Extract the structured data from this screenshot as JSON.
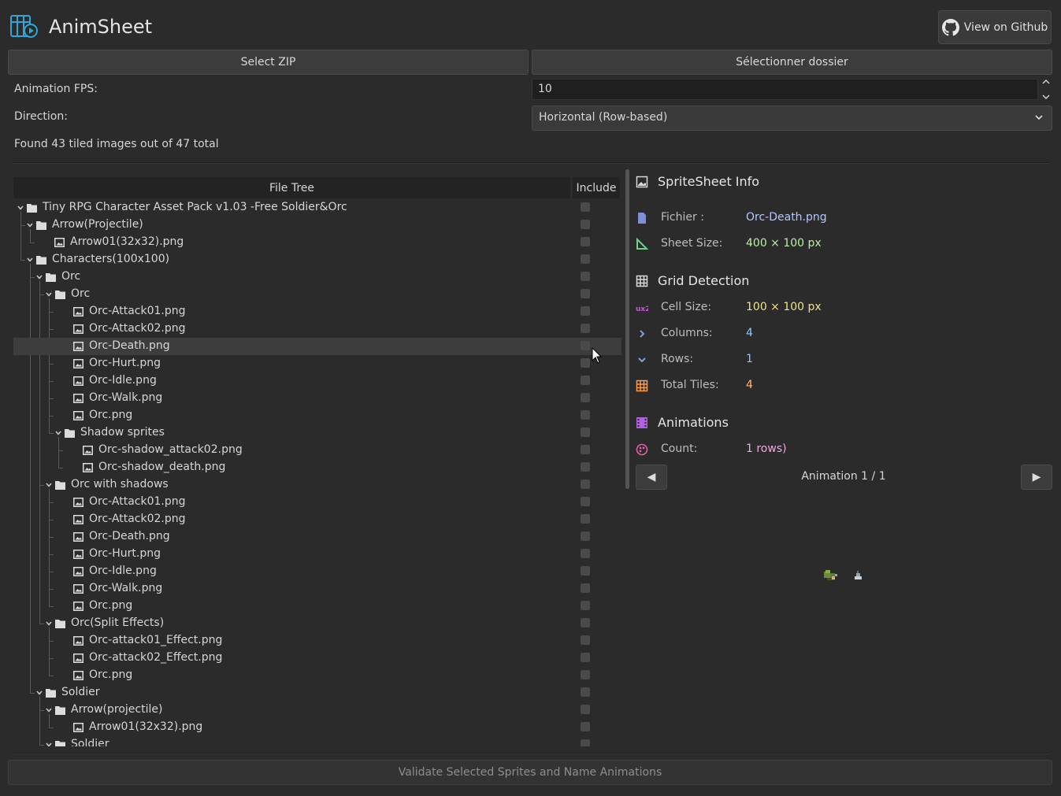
{
  "app": {
    "title": "AnimSheet",
    "logo_icon": "film-grid-icon"
  },
  "header": {
    "github_label": "View on Github",
    "github_icon": "github-icon"
  },
  "toolbar": {
    "select_zip": "Select ZIP",
    "select_folder": "Sélectionner dossier"
  },
  "settings": {
    "fps_label": "Animation FPS:",
    "fps_value": "10",
    "direction_label": "Direction:",
    "direction_value": "Horizontal (Row-based)"
  },
  "status": "Found 43 tiled images out of 47 total",
  "tree": {
    "header_file": "File Tree",
    "header_include": "Include",
    "nodes": [
      {
        "label": "Tiny RPG Character Asset Pack v1.03 -Free Soldier&Orc",
        "type": "folder",
        "depth": 0,
        "expanded": true
      },
      {
        "label": "Arrow(Projectile)",
        "type": "folder",
        "depth": 1,
        "expanded": true
      },
      {
        "label": "Arrow01(32x32).png",
        "type": "file",
        "depth": 2
      },
      {
        "label": "Characters(100x100)",
        "type": "folder",
        "depth": 1,
        "expanded": true
      },
      {
        "label": "Orc",
        "type": "folder",
        "depth": 2,
        "expanded": true
      },
      {
        "label": "Orc",
        "type": "folder",
        "depth": 3,
        "expanded": true
      },
      {
        "label": "Orc-Attack01.png",
        "type": "file",
        "depth": 4
      },
      {
        "label": "Orc-Attack02.png",
        "type": "file",
        "depth": 4
      },
      {
        "label": "Orc-Death.png",
        "type": "file",
        "depth": 4,
        "selected": true
      },
      {
        "label": "Orc-Hurt.png",
        "type": "file",
        "depth": 4
      },
      {
        "label": "Orc-Idle.png",
        "type": "file",
        "depth": 4
      },
      {
        "label": "Orc-Walk.png",
        "type": "file",
        "depth": 4
      },
      {
        "label": "Orc.png",
        "type": "file",
        "depth": 4
      },
      {
        "label": "Shadow sprites",
        "type": "folder",
        "depth": 4,
        "expanded": true
      },
      {
        "label": "Orc-shadow_attack02.png",
        "type": "file",
        "depth": 5
      },
      {
        "label": "Orc-shadow_death.png",
        "type": "file",
        "depth": 5
      },
      {
        "label": "Orc with shadows",
        "type": "folder",
        "depth": 3,
        "expanded": true
      },
      {
        "label": "Orc-Attack01.png",
        "type": "file",
        "depth": 4
      },
      {
        "label": "Orc-Attack02.png",
        "type": "file",
        "depth": 4
      },
      {
        "label": "Orc-Death.png",
        "type": "file",
        "depth": 4
      },
      {
        "label": "Orc-Hurt.png",
        "type": "file",
        "depth": 4
      },
      {
        "label": "Orc-Idle.png",
        "type": "file",
        "depth": 4
      },
      {
        "label": "Orc-Walk.png",
        "type": "file",
        "depth": 4
      },
      {
        "label": "Orc.png",
        "type": "file",
        "depth": 4
      },
      {
        "label": "Orc(Split Effects)",
        "type": "folder",
        "depth": 3,
        "expanded": true
      },
      {
        "label": "Orc-attack01_Effect.png",
        "type": "file",
        "depth": 4
      },
      {
        "label": "Orc-attack02_Effect.png",
        "type": "file",
        "depth": 4
      },
      {
        "label": "Orc.png",
        "type": "file",
        "depth": 4
      },
      {
        "label": "Soldier",
        "type": "folder",
        "depth": 2,
        "expanded": true
      },
      {
        "label": "Arrow(projectile)",
        "type": "folder",
        "depth": 3,
        "expanded": true
      },
      {
        "label": "Arrow01(32x32).png",
        "type": "file",
        "depth": 4
      },
      {
        "label": "Soldier",
        "type": "folder",
        "depth": 3,
        "expanded": true
      }
    ]
  },
  "info": {
    "spritesheet_title": "SpriteSheet Info",
    "file_label": "Fichier :",
    "file_value": "Orc-Death.png",
    "size_label": "Sheet Size:",
    "size_value": "400 × 100 px",
    "grid_title": "Grid Detection",
    "cell_label": "Cell Size:",
    "cell_value": "100 × 100 px",
    "columns_label": "Columns:",
    "columns_value": "4",
    "rows_label": "Rows:",
    "rows_value": "1",
    "tiles_label": "Total Tiles:",
    "tiles_value": "4",
    "anim_title": "Animations",
    "count_label": "Count:",
    "count_value": "1 rows)",
    "anim_nav": "Animation 1 / 1",
    "prev_glyph": "◀",
    "next_glyph": "▶"
  },
  "colors": {
    "file_value": "#b6c8ff",
    "size_value": "#b9f0a4",
    "cell_value": "#f0e08a",
    "columns_value": "#8ec8ff",
    "rows_value": "#8ec8ff",
    "tiles_value": "#ffb86b",
    "count_value": "#f4a6e6",
    "anim_icon": "#b060e0"
  },
  "footer": {
    "validate_label": "Validate Selected Sprites and Name Animations"
  }
}
